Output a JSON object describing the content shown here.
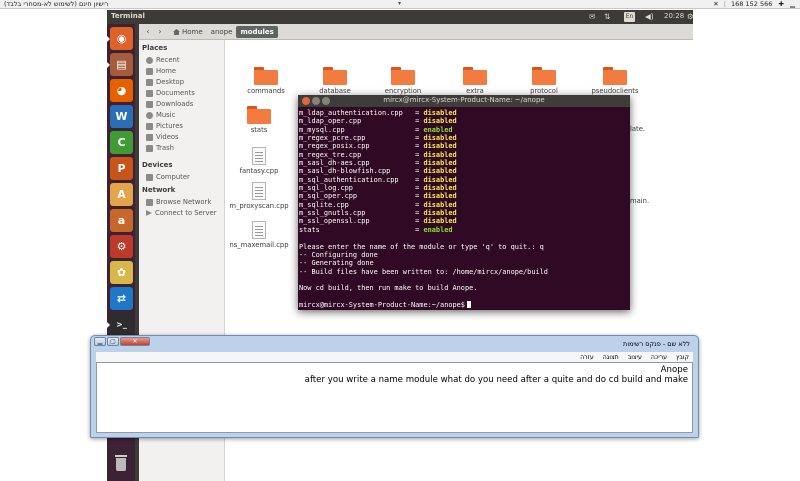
{
  "remote_bar": {
    "title": "רישיון חינם (לשימוש לא-מסחרי בלבד)",
    "address": "168 152 566"
  },
  "panel": {
    "title": "Terminal",
    "keyboard": "En",
    "clock": "20:28"
  },
  "launcher": {
    "items": [
      {
        "name": "ubuntu-dash",
        "color": "#e0622b",
        "glyph": "◉"
      },
      {
        "name": "files",
        "color": "#a65b3b",
        "glyph": "▤"
      },
      {
        "name": "firefox",
        "color": "#e66000",
        "glyph": "◕"
      },
      {
        "name": "writer",
        "color": "#2a6fb5",
        "glyph": "W"
      },
      {
        "name": "calc",
        "color": "#3f9c35",
        "glyph": "C"
      },
      {
        "name": "impress",
        "color": "#c9541b",
        "glyph": "P"
      },
      {
        "name": "software-center",
        "color": "#e3a44c",
        "glyph": "A"
      },
      {
        "name": "amazon",
        "color": "#c7682b",
        "glyph": "a"
      },
      {
        "name": "system-settings",
        "color": "#bd3a2a",
        "glyph": "⚙"
      },
      {
        "name": "xchat",
        "color": "#d8b84a",
        "glyph": "✿"
      },
      {
        "name": "teamviewer",
        "color": "#1e77c7",
        "glyph": "⇄"
      },
      {
        "name": "terminal",
        "color": "#2d2d2d",
        "glyph": ">_"
      }
    ]
  },
  "nautilus": {
    "breadcrumbs": [
      "Home",
      "anope",
      "modules"
    ],
    "sidebar": {
      "places_header": "Places",
      "places": [
        "Recent",
        "Home",
        "Desktop",
        "Documents",
        "Downloads",
        "Music",
        "Pictures",
        "Videos",
        "Trash"
      ],
      "devices_header": "Devices",
      "devices": [
        "Computer"
      ],
      "network_header": "Network",
      "network": [
        "Browse Network",
        "Connect to Server"
      ]
    },
    "files": {
      "row1": [
        "commands",
        "database",
        "encryption",
        "extra",
        "protocol",
        "pseudoclients"
      ],
      "stats": "stats",
      "fantasy": "fantasy.cpp",
      "proxyscan": "m_proxyscan.cpp",
      "maxemail": "ns_maxemail.cpp",
      "cut_right_1": "late.",
      "cut_right_2": "main."
    }
  },
  "terminal": {
    "title": "mircx@mircx-System-Product-Name: ~/anope",
    "modules": [
      {
        "name": "m_ldap_authentication.cpp",
        "status": "disabled"
      },
      {
        "name": "m_ldap_oper.cpp",
        "status": "disabled"
      },
      {
        "name": "m_mysql.cpp",
        "status": "enabled"
      },
      {
        "name": "m_regex_pcre.cpp",
        "status": "disabled"
      },
      {
        "name": "m_regex_posix.cpp",
        "status": "disabled"
      },
      {
        "name": "m_regex_tre.cpp",
        "status": "disabled"
      },
      {
        "name": "m_sasl_dh-aes.cpp",
        "status": "disabled"
      },
      {
        "name": "m_sasl_dh-blowfish.cpp",
        "status": "disabled"
      },
      {
        "name": "m_sql_authentication.cpp",
        "status": "disabled"
      },
      {
        "name": "m_sql_log.cpp",
        "status": "disabled"
      },
      {
        "name": "m_sql_oper.cpp",
        "status": "disabled"
      },
      {
        "name": "m_sqlite.cpp",
        "status": "disabled"
      },
      {
        "name": "m_ssl_gnutls.cpp",
        "status": "disabled"
      },
      {
        "name": "m_ssl_openssl.cpp",
        "status": "disabled"
      },
      {
        "name": "stats",
        "status": "enabled"
      }
    ],
    "messages": [
      "Please enter the name of the module or type 'q' to quit.: q",
      "-- Configuring done",
      "-- Generating done",
      "-- Build files have been written to: /home/mircx/anope/build",
      "",
      "Now cd build, then run make to build Anope.",
      ""
    ],
    "prompt": "mircx@mircx-System-Product-Name:~/anope$"
  },
  "notepad": {
    "title": "ללא שם - פנקס רשימות",
    "menu": [
      "קובץ",
      "עריכה",
      "עיצוב",
      "תצוגה",
      "עזרה"
    ],
    "lines": [
      "Anope",
      "after you write a name module what do you need after a quite and do cd build and make"
    ]
  }
}
